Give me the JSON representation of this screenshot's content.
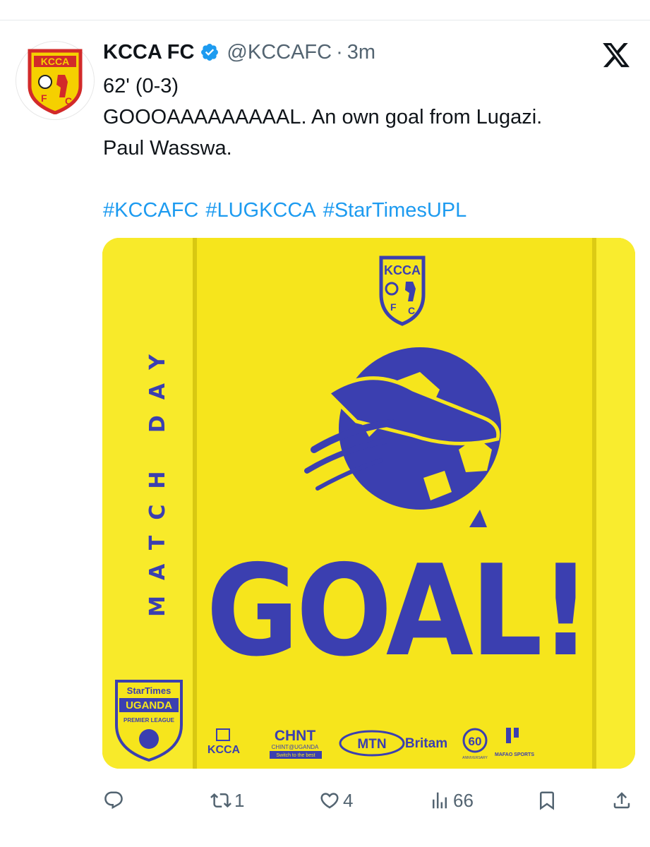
{
  "tweet": {
    "display_name": "KCCA FC",
    "handle": "@KCCAFC",
    "separator": "·",
    "time": "3m",
    "lines": [
      "62' (0-3)",
      "GOOOAAAAAAAAAL. An own goal from Lugazi.",
      "Paul Wasswa."
    ],
    "hashtags": [
      "#KCCAFC",
      "#LUGKCCA",
      "#StarTimesUPL"
    ]
  },
  "media": {
    "side_label": "MATCH DAY",
    "headline": "GOAL!",
    "crest_text": "KCCA",
    "league": {
      "sponsor": "StarTimes",
      "name": "UGANDA",
      "sub": "PREMIER LEAGUE"
    },
    "sponsors": {
      "kcca": "KCCA",
      "chint": "CHNT",
      "chint_sub": "CHINT@UGANDA",
      "chint_tag": "Switch to the best",
      "mtn": "MTN",
      "britam": "Britam",
      "anniversary": "60",
      "anniversary_sub": "ANNIVERSARY",
      "mafao": "MAFAO SPORTS"
    }
  },
  "stats": {
    "replies": "",
    "reposts": "1",
    "likes": "4",
    "views": "66"
  },
  "colors": {
    "accent": "#1d9bf0",
    "muted": "#536471",
    "poster_yellow": "#f4e21a",
    "poster_blue": "#3b3fb0",
    "crest_red": "#d22a2a",
    "crest_yellow": "#f5d000"
  }
}
